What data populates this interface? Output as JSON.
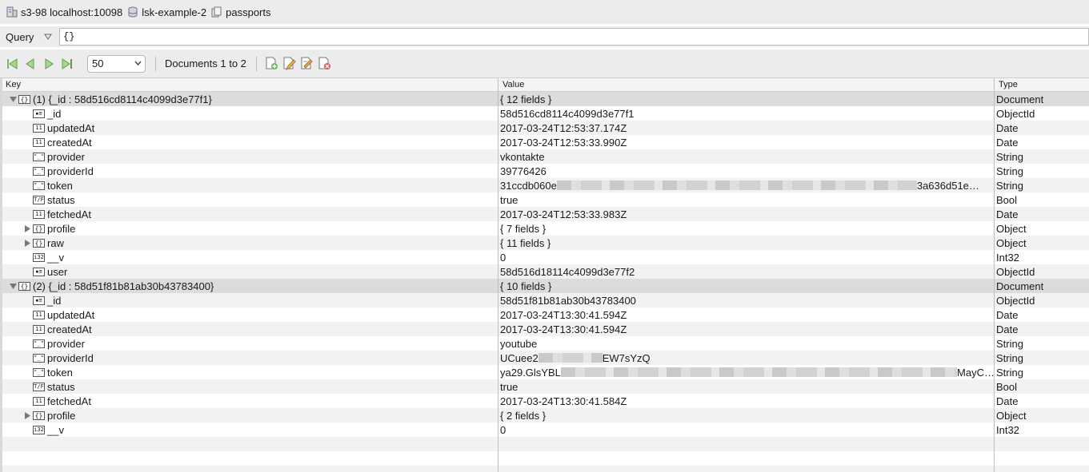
{
  "breadcrumb": {
    "server": "s3-98 localhost:10098",
    "database": "lsk-example-2",
    "collection": "passports"
  },
  "query": {
    "label": "Query",
    "value": "{}"
  },
  "toolbar": {
    "page_size": "50",
    "doc_range": "Documents 1 to 2"
  },
  "columns": {
    "key": "Key",
    "value": "Value",
    "type": "Type"
  },
  "rows": [
    {
      "level": 0,
      "tri": "down",
      "icon": "{}",
      "key": "(1) {_id : 58d516cd8114c4099d3e77f1}",
      "value": "{ 12 fields }",
      "type": "Document"
    },
    {
      "level": 1,
      "tri": "",
      "icon": "id",
      "key": "_id",
      "value": "58d516cd8114c4099d3e77f1",
      "type": "ObjectId"
    },
    {
      "level": 1,
      "tri": "",
      "icon": "11",
      "key": "updatedAt",
      "value": "2017-03-24T12:53:37.174Z",
      "type": "Date"
    },
    {
      "level": 1,
      "tri": "",
      "icon": "11",
      "key": "createdAt",
      "value": "2017-03-24T12:53:33.990Z",
      "type": "Date"
    },
    {
      "level": 1,
      "tri": "",
      "icon": "\"\"",
      "key": "provider",
      "value": "vkontakte",
      "type": "String"
    },
    {
      "level": 1,
      "tri": "",
      "icon": "\"\"",
      "key": "providerId",
      "value": "39776426",
      "type": "String"
    },
    {
      "level": 1,
      "tri": "",
      "icon": "\"\"",
      "key": "token",
      "value_prefix": "31ccdb060e",
      "value_suffix": "3a636d51e…",
      "blur_width": 450,
      "type": "String"
    },
    {
      "level": 1,
      "tri": "",
      "icon": "T/F",
      "key": "status",
      "value": "true",
      "type": "Bool"
    },
    {
      "level": 1,
      "tri": "",
      "icon": "11",
      "key": "fetchedAt",
      "value": "2017-03-24T12:53:33.983Z",
      "type": "Date"
    },
    {
      "level": 1,
      "tri": "right",
      "icon": "{}",
      "key": "profile",
      "value": "{ 7 fields }",
      "type": "Object"
    },
    {
      "level": 1,
      "tri": "right",
      "icon": "{}",
      "key": "raw",
      "value": "{ 11 fields }",
      "type": "Object"
    },
    {
      "level": 1,
      "tri": "",
      "icon": "i32",
      "key": "__v",
      "value": "0",
      "type": "Int32"
    },
    {
      "level": 1,
      "tri": "",
      "icon": "id",
      "key": "user",
      "value": "58d516d18114c4099d3e77f2",
      "type": "ObjectId"
    },
    {
      "level": 0,
      "tri": "down",
      "icon": "{}",
      "key": "(2) {_id : 58d51f81b81ab30b43783400}",
      "value": "{ 10 fields }",
      "type": "Document"
    },
    {
      "level": 1,
      "tri": "",
      "icon": "id",
      "key": "_id",
      "value": "58d51f81b81ab30b43783400",
      "type": "ObjectId"
    },
    {
      "level": 1,
      "tri": "",
      "icon": "11",
      "key": "updatedAt",
      "value": "2017-03-24T13:30:41.594Z",
      "type": "Date"
    },
    {
      "level": 1,
      "tri": "",
      "icon": "11",
      "key": "createdAt",
      "value": "2017-03-24T13:30:41.594Z",
      "type": "Date"
    },
    {
      "level": 1,
      "tri": "",
      "icon": "\"\"",
      "key": "provider",
      "value": "youtube",
      "type": "String"
    },
    {
      "level": 1,
      "tri": "",
      "icon": "\"\"",
      "key": "providerId",
      "value_prefix": "UCuee2",
      "value_suffix": "EW7sYzQ",
      "blur_width": 80,
      "type": "String"
    },
    {
      "level": 1,
      "tri": "",
      "icon": "\"\"",
      "key": "token",
      "value_prefix": "ya29.GlsYBL",
      "value_suffix": "MayC…",
      "blur_width": 496,
      "type": "String"
    },
    {
      "level": 1,
      "tri": "",
      "icon": "T/F",
      "key": "status",
      "value": "true",
      "type": "Bool"
    },
    {
      "level": 1,
      "tri": "",
      "icon": "11",
      "key": "fetchedAt",
      "value": "2017-03-24T13:30:41.584Z",
      "type": "Date"
    },
    {
      "level": 1,
      "tri": "right",
      "icon": "{}",
      "key": "profile",
      "value": "{ 2 fields }",
      "type": "Object"
    },
    {
      "level": 1,
      "tri": "",
      "icon": "i32",
      "key": "__v",
      "value": "0",
      "type": "Int32"
    }
  ]
}
